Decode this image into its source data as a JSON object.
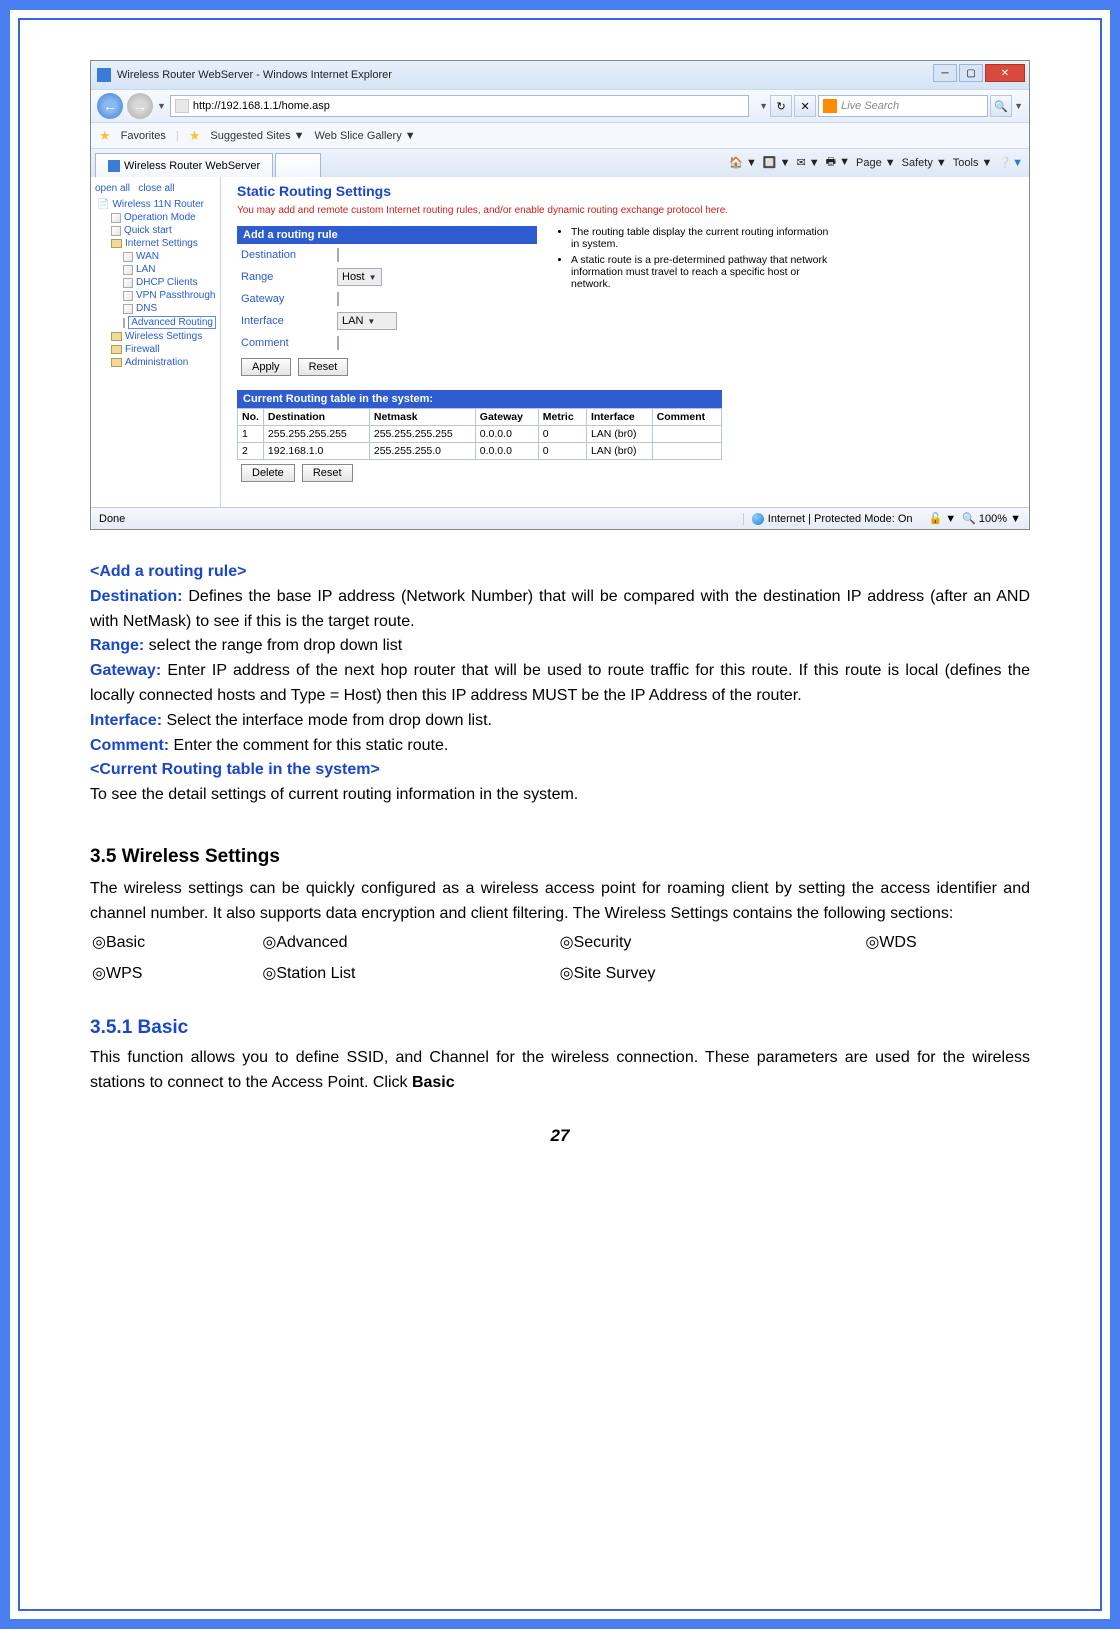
{
  "browser": {
    "title": "Wireless Router WebServer - Windows Internet Explorer",
    "url": "http://192.168.1.1/home.asp",
    "search_placeholder": "Live Search",
    "favorites_label": "Favorites",
    "suggested_sites": "Suggested Sites ▼",
    "web_slice": "Web Slice Gallery ▼",
    "tab_label": "Wireless Router WebServer",
    "toolbar": {
      "page": "Page ▼",
      "safety": "Safety ▼",
      "tools": "Tools ▼"
    },
    "status_left": "Done",
    "status_mid": "Internet | Protected Mode: On",
    "status_zoom": "100%"
  },
  "sidebar": {
    "open_all": "open all",
    "close_all": "close all",
    "root": "Wireless 11N Router",
    "operation_mode": "Operation Mode",
    "quick_start": "Quick start",
    "internet_settings": "Internet Settings",
    "wan": "WAN",
    "lan": "LAN",
    "dhcp": "DHCP Clients",
    "vpn": "VPN Passthrough",
    "dns": "DNS",
    "adv_routing": "Advanced Routing",
    "wireless_settings": "Wireless Settings",
    "firewall": "Firewall",
    "administration": "Administration"
  },
  "main": {
    "title": "Static Routing Settings",
    "note": "You may add and remote custom Internet routing rules, and/or enable dynamic routing exchange protocol here.",
    "form": {
      "header": "Add a routing rule",
      "destination": "Destination",
      "range": "Range",
      "range_val": "Host",
      "gateway": "Gateway",
      "interface": "Interface",
      "interface_val": "LAN",
      "comment": "Comment",
      "apply": "Apply",
      "reset": "Reset"
    },
    "info": {
      "b1": "The routing table display the current routing information in system.",
      "b2": "A static route is a pre-determined pathway that network information must travel to reach a specific host or network."
    },
    "table": {
      "header": "Current Routing table in the system:",
      "cols": [
        "No.",
        "Destination",
        "Netmask",
        "Gateway",
        "Metric",
        "Interface",
        "Comment"
      ],
      "rows": [
        {
          "no": "1",
          "dest": "255.255.255.255",
          "mask": "255.255.255.255",
          "gw": "0.0.0.0",
          "metric": "0",
          "if": "LAN (br0)",
          "comment": ""
        },
        {
          "no": "2",
          "dest": "192.168.1.0",
          "mask": "255.255.255.0",
          "gw": "0.0.0.0",
          "metric": "0",
          "if": "LAN (br0)",
          "comment": ""
        }
      ],
      "delete": "Delete",
      "reset": "Reset"
    }
  },
  "doc": {
    "h_add_rule": "<Add a routing rule>",
    "dest_lbl": "Destination:",
    "dest_txt": " Defines the base IP address (Network Number) that will be compared with the destination IP address (after an AND with NetMask) to see if this is the target route.",
    "range_lbl": "Range:",
    "range_txt": " select the range from drop down list",
    "gw_lbl": "Gateway:",
    "gw_txt": " Enter IP address of the next hop router that will be used to route traffic for this route. If this route is local (defines the locally connected hosts and Type = Host) then this IP address MUST be the IP Address of the router.",
    "if_lbl": "Interface:",
    "if_txt": " Select the interface mode from drop down list.",
    "cm_lbl": "Comment:",
    "cm_txt": " Enter the comment for this static route.",
    "h_current": "<Current Routing table in the system>",
    "current_txt": "To see the detail settings of current routing information in the system.",
    "h35": "3.5   Wireless Settings",
    "p35": "The wireless settings can be quickly configured as a wireless access point for roaming client by setting the access identifier and channel number. It also supports data encryption and client filtering. The Wireless Settings contains the following sections:",
    "sec_basic": "Basic",
    "sec_advanced": "Advanced",
    "sec_security": "Security",
    "sec_wds": "WDS",
    "sec_wps": "WPS",
    "sec_stationlist": "Station List",
    "sec_sitesurvey": "Site Survey",
    "h351": "3.5.1   Basic",
    "p351a": "This function allows you to define SSID, and Channel for the wireless connection. These parameters are used for the wireless stations to connect to the Access Point. Click ",
    "p351b": "Basic",
    "page_number": "27"
  },
  "chart_data": {
    "type": "table",
    "title": "Current Routing table in the system:",
    "columns": [
      "No.",
      "Destination",
      "Netmask",
      "Gateway",
      "Metric",
      "Interface",
      "Comment"
    ],
    "rows": [
      [
        "1",
        "255.255.255.255",
        "255.255.255.255",
        "0.0.0.0",
        "0",
        "LAN (br0)",
        ""
      ],
      [
        "2",
        "192.168.1.0",
        "255.255.255.0",
        "0.0.0.0",
        "0",
        "LAN (br0)",
        ""
      ]
    ]
  }
}
